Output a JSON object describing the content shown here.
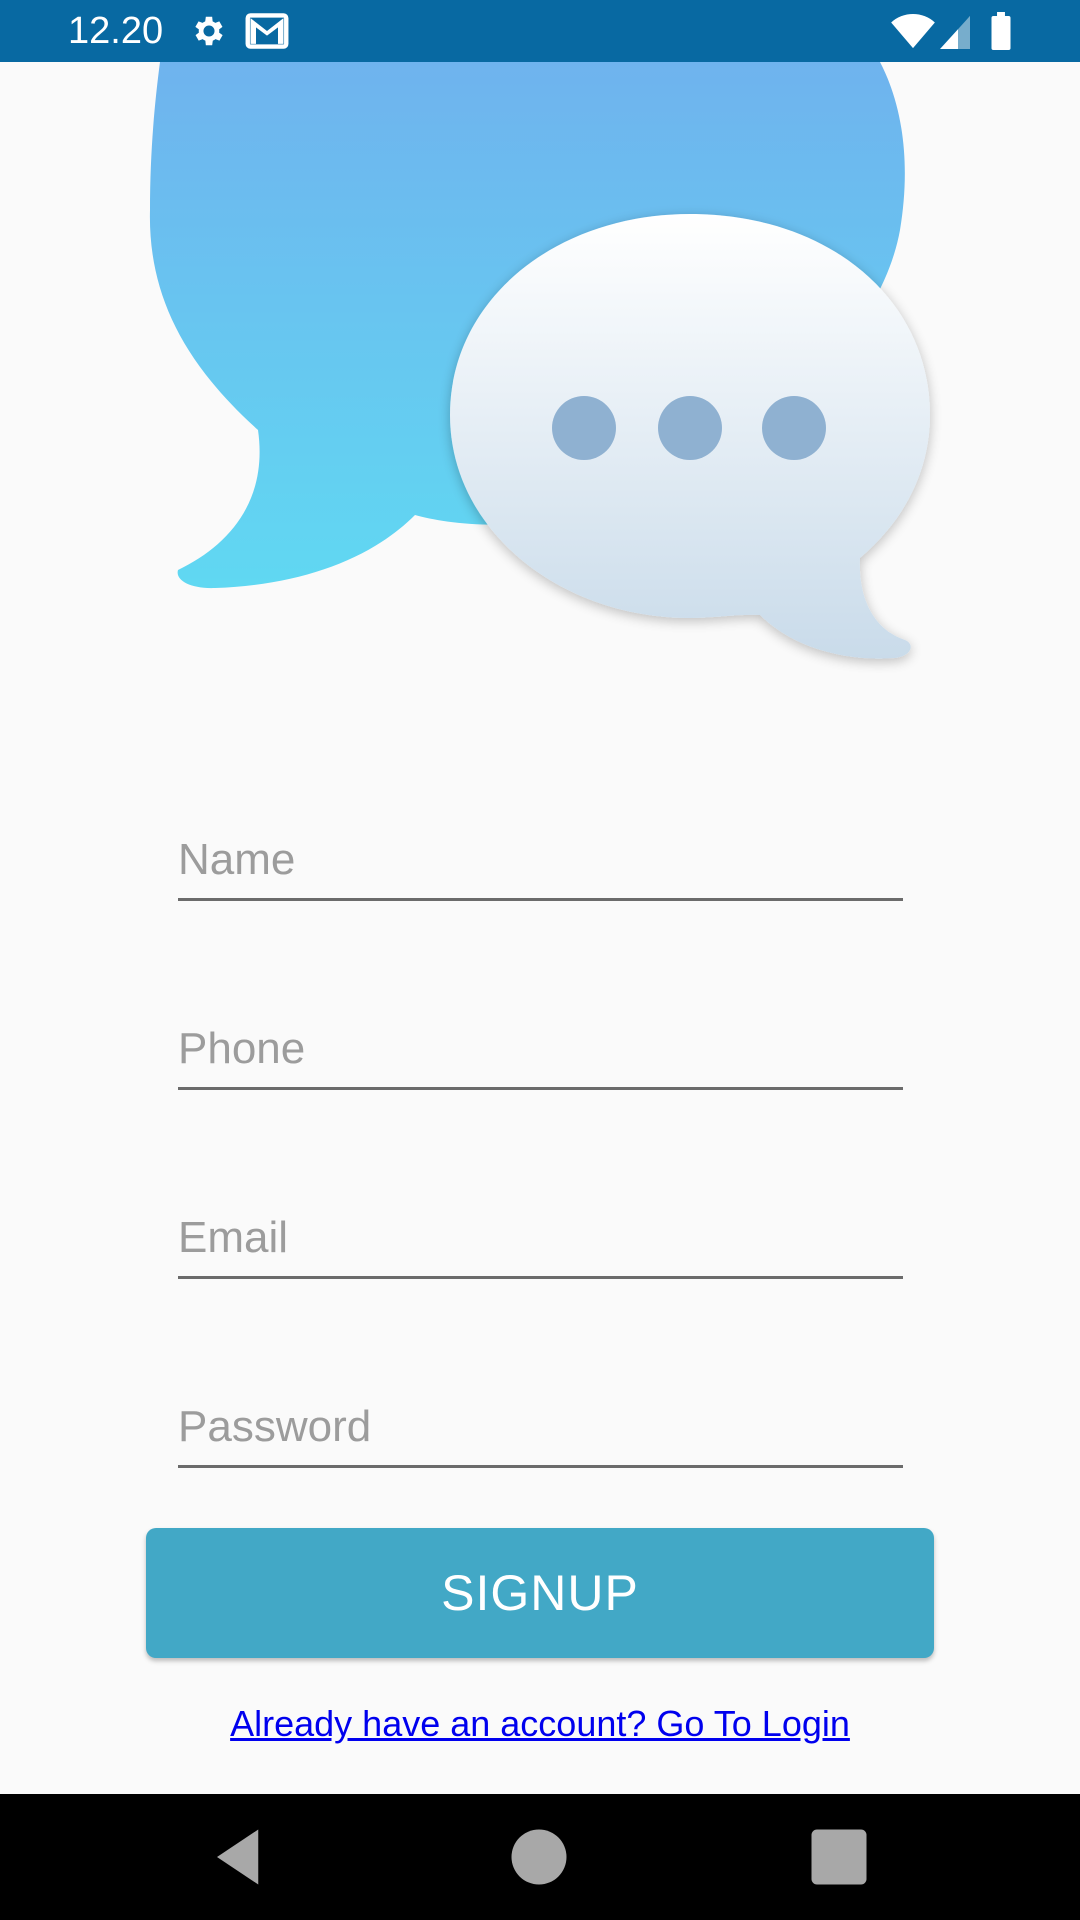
{
  "status_bar": {
    "time": "12.20",
    "background": "#0869a2",
    "icons": [
      "gear-icon",
      "gmail-icon",
      "wifi-icon",
      "signal-icon",
      "battery-icon"
    ]
  },
  "logo": {
    "icon": "chat-bubbles-icon"
  },
  "form": {
    "name_placeholder": "Name",
    "phone_placeholder": "Phone",
    "email_placeholder": "Email",
    "password_placeholder": "Password"
  },
  "signup_button": {
    "label": "SIGNUP",
    "color": "#42a8c6"
  },
  "login_link": {
    "label": "Already have an account? Go To Login",
    "color": "#0000ee"
  },
  "nav_bar": {
    "icons": [
      "back-icon",
      "home-icon",
      "recents-icon"
    ]
  }
}
